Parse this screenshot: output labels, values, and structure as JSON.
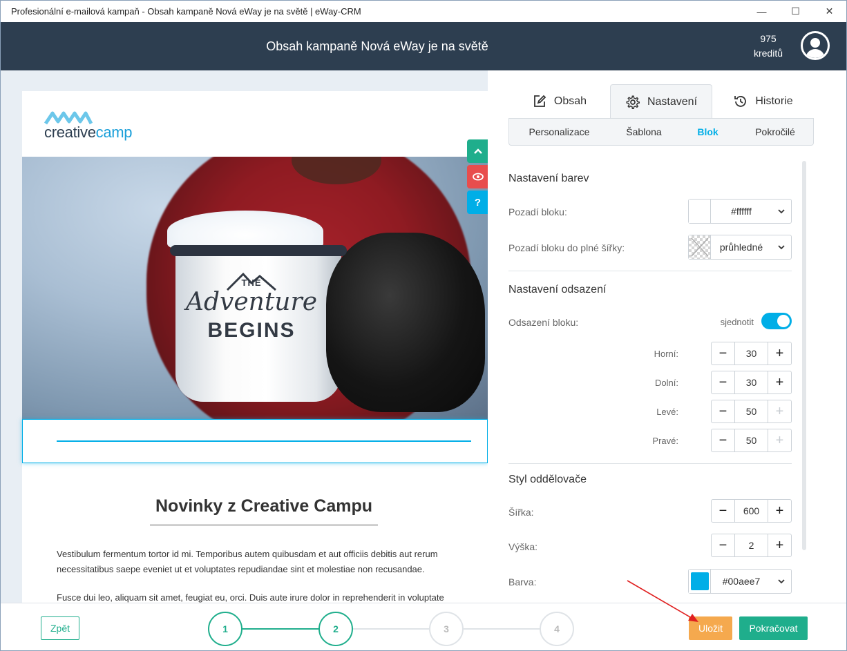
{
  "window": {
    "title": "Profesionální e-mailová kampaň - Obsah kampaně Nová eWay je na světě | eWay-CRM",
    "minimize": "—",
    "maximize": "☐",
    "close": "✕"
  },
  "header": {
    "title_prefix": "Obsah kampaně",
    "title_campaign": "Nová eWay je na světě",
    "credits_value": "975",
    "credits_label": "kreditů"
  },
  "preview": {
    "logo_part1": "creative",
    "logo_part2": "camp",
    "mug_text_top": "THE",
    "mug_text_mid": "Adventure",
    "mug_text_bottom": "BEGINS",
    "side_buttons": [
      {
        "icon": "chevron-up-icon",
        "glyph": "⌃",
        "color": "#1fae8c"
      },
      {
        "icon": "eye-icon",
        "glyph": "◉",
        "color": "#e84d4d"
      },
      {
        "icon": "help-icon",
        "glyph": "?",
        "color": "#00aee7"
      }
    ],
    "article_title": "Novinky z Creative Campu",
    "paragraph1": "Vestibulum fermentum tortor id mi. Temporibus autem quibusdam et aut officiis debitis aut rerum necessitatibus saepe eveniet ut et voluptates repudiandae sint et molestiae non recusandae.",
    "paragraph2": "Fusce dui leo, aliquam sit amet, feugiat eu, orci. Duis aute irure dolor in reprehenderit in voluptate"
  },
  "panel": {
    "tabs": [
      {
        "label": "Obsah",
        "icon": "edit-icon"
      },
      {
        "label": "Nastavení",
        "icon": "gear-icon"
      },
      {
        "label": "Historie",
        "icon": "history-icon"
      }
    ],
    "active_tab": "Nastavení",
    "subtabs": [
      "Personalizace",
      "Šablona",
      "Blok",
      "Pokročilé"
    ],
    "active_subtab": "Blok",
    "colors_section": {
      "title": "Nastavení barev",
      "block_bg_label": "Pozadí bloku:",
      "block_bg_value": "#ffffff",
      "full_bg_label": "Pozadí bloku do plné šířky:",
      "full_bg_value": "průhledné"
    },
    "padding_section": {
      "title": "Nastavení odsazení",
      "block_padding_label": "Odsazení bloku:",
      "unify_label": "sjednotit",
      "unify_on": true,
      "top_label": "Horní:",
      "top_value": "30",
      "bottom_label": "Dolní:",
      "bottom_value": "30",
      "left_label": "Levé:",
      "left_value": "50",
      "right_label": "Pravé:",
      "right_value": "50"
    },
    "divider_section": {
      "title": "Styl oddělovače",
      "width_label": "Šířka:",
      "width_value": "600",
      "height_label": "Výška:",
      "height_value": "2",
      "color_label": "Barva:",
      "color_value": "#00aee7"
    }
  },
  "footer": {
    "back_label": "Zpět",
    "steps": [
      "1",
      "2",
      "3",
      "4"
    ],
    "completed_steps": 2,
    "save_label": "Uložit",
    "continue_label": "Pokračovat"
  },
  "colors": {
    "header_bg": "#2d3e50",
    "accent": "#00aee7",
    "green": "#1fae8c",
    "save_orange": "#f5a94e",
    "annotation_arrow": "#e02020"
  }
}
